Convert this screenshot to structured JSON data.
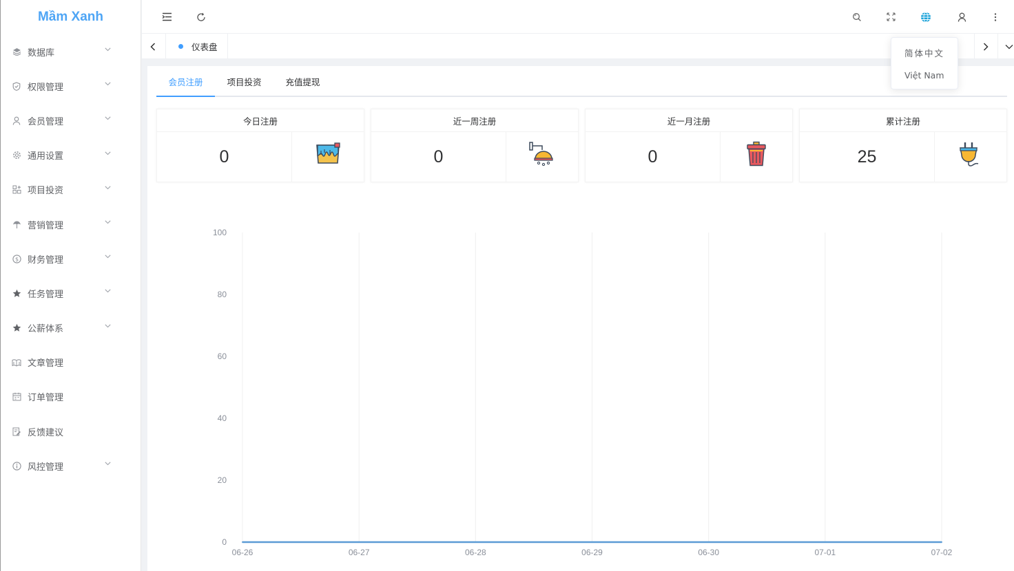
{
  "app": {
    "title": "Mầm Xanh"
  },
  "sidebar": {
    "items": [
      {
        "label": "数据库",
        "icon": "layers-icon",
        "has_children": true
      },
      {
        "label": "权限管理",
        "icon": "shield-check-icon",
        "has_children": true
      },
      {
        "label": "会员管理",
        "icon": "user-icon",
        "has_children": true
      },
      {
        "label": "通用设置",
        "icon": "gear-icon",
        "has_children": true
      },
      {
        "label": "项目投资",
        "icon": "grid-add-icon",
        "has_children": true
      },
      {
        "label": "营销管理",
        "icon": "umbrella-icon",
        "has_children": true
      },
      {
        "label": "财务管理",
        "icon": "dollar-circle-icon",
        "has_children": true
      },
      {
        "label": "任务管理",
        "icon": "star-icon",
        "has_children": true
      },
      {
        "label": "公薪体系",
        "icon": "star-icon",
        "has_children": true
      },
      {
        "label": "文章管理",
        "icon": "book-open-icon",
        "has_children": false
      },
      {
        "label": "订单管理",
        "icon": "calendar-icon",
        "has_children": false
      },
      {
        "label": "反馈建议",
        "icon": "edit-note-icon",
        "has_children": false
      },
      {
        "label": "风控管理",
        "icon": "info-circle-icon",
        "has_children": true
      }
    ]
  },
  "header": {
    "icons": [
      "menu-fold-icon",
      "refresh-icon",
      "search-icon",
      "fullscreen-icon",
      "globe-icon",
      "user-icon",
      "more-vertical-icon"
    ],
    "accent": "#1ba3d9"
  },
  "tags": {
    "items": [
      {
        "label": "仪表盘",
        "active": true
      }
    ]
  },
  "language_menu": {
    "options": [
      "简体中文",
      "Việt Nam"
    ]
  },
  "tabs": {
    "items": [
      {
        "label": "会员注册",
        "active": true
      },
      {
        "label": "项目投资",
        "active": false
      },
      {
        "label": "充值提现",
        "active": false
      }
    ]
  },
  "stats": [
    {
      "title": "今日注册",
      "value": "0",
      "icon": "paint-bucket-icon"
    },
    {
      "title": "近一周注册",
      "value": "0",
      "icon": "shower-head-icon"
    },
    {
      "title": "近一月注册",
      "value": "0",
      "icon": "trash-bin-icon"
    },
    {
      "title": "累计注册",
      "value": "25",
      "icon": "power-plug-icon"
    }
  ],
  "chart_data": {
    "type": "line",
    "x": [
      "06-26",
      "06-27",
      "06-28",
      "06-29",
      "06-30",
      "07-01",
      "07-02"
    ],
    "series": [
      {
        "values": [
          0,
          0,
          0,
          0,
          0,
          0,
          0
        ],
        "color": "#5b9bd5"
      }
    ],
    "yticks": [
      0,
      20,
      40,
      60,
      80,
      100
    ],
    "ylim": [
      0,
      100
    ],
    "grid": "vertical",
    "legend": "none"
  }
}
